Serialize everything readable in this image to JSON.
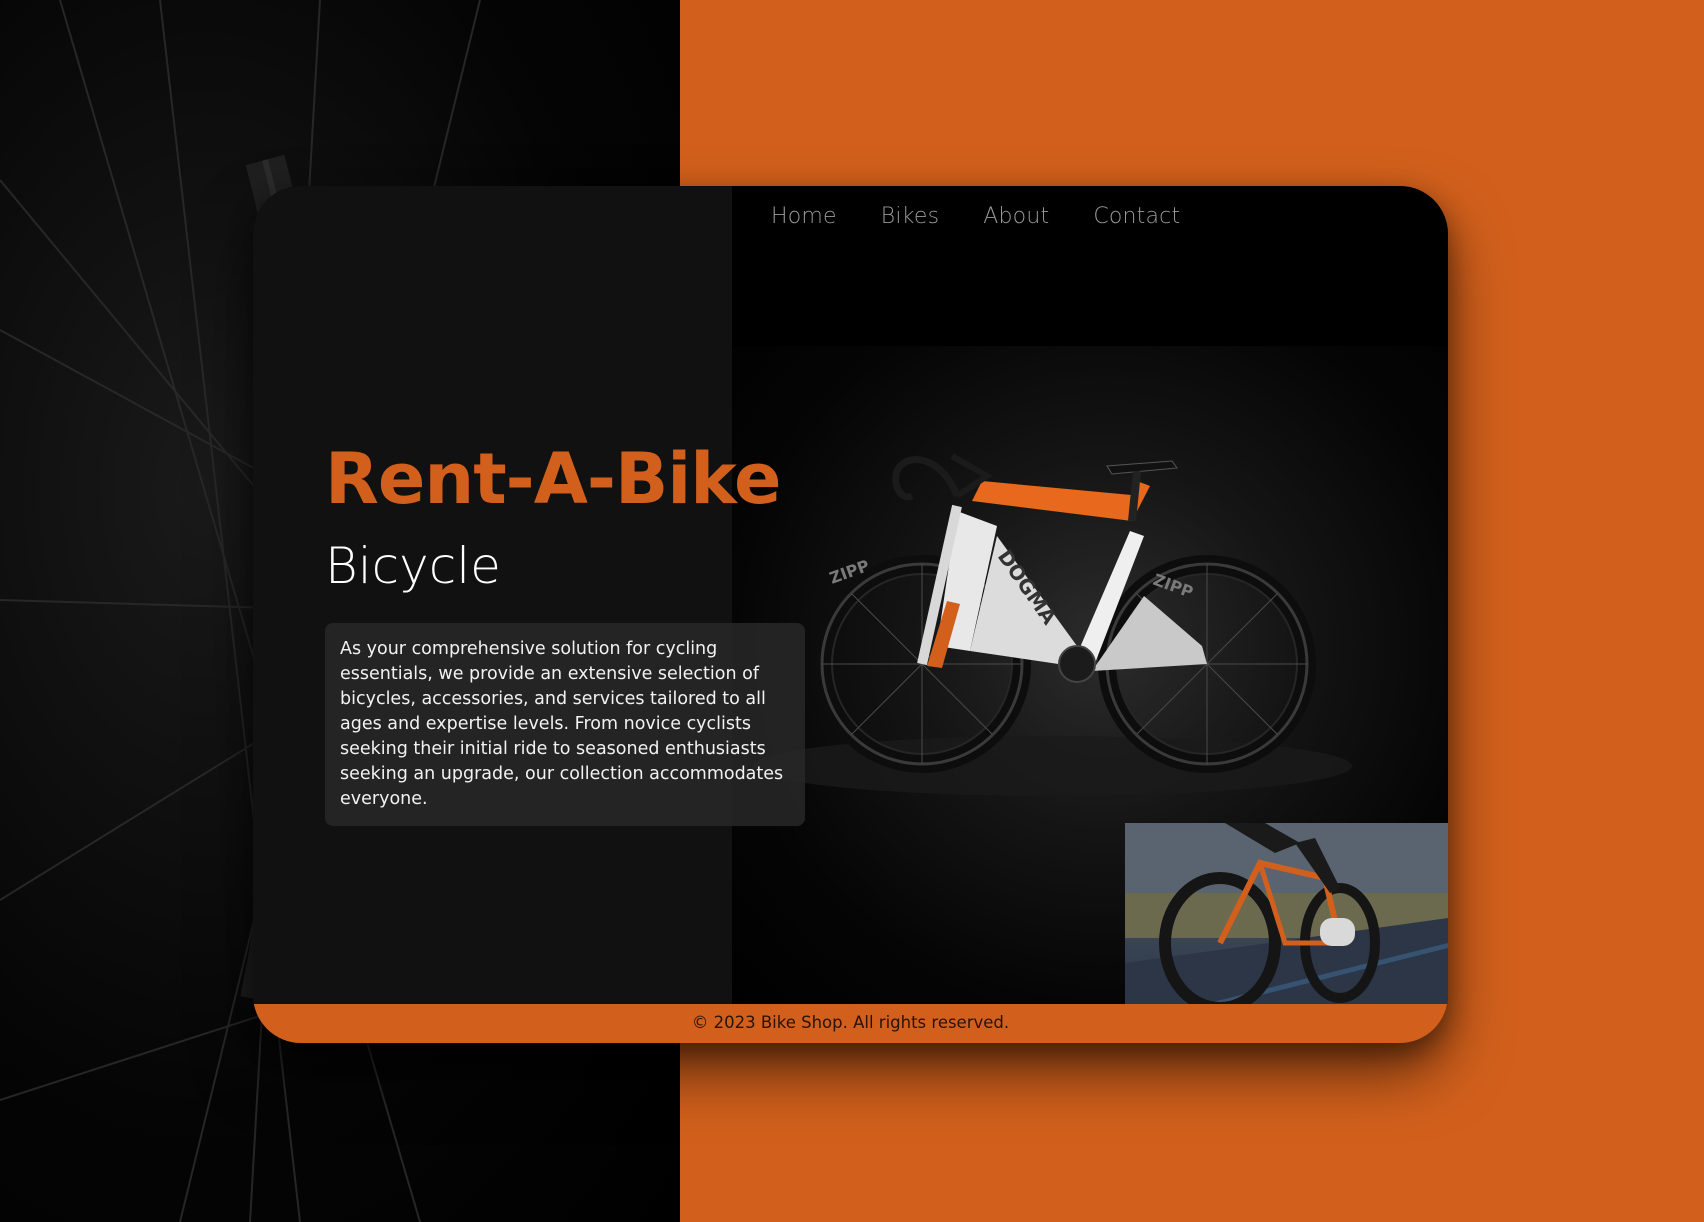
{
  "nav": {
    "items": [
      {
        "label": "Home"
      },
      {
        "label": "Bikes"
      },
      {
        "label": "About"
      },
      {
        "label": "Contact"
      }
    ]
  },
  "hero": {
    "title": "Rent-A-Bike",
    "subtitle": "Bicycle",
    "description": "As your comprehensive solution for cycling essentials, we provide an extensive selection of bicycles, accessories, and services tailored to all ages and expertise levels. From novice cyclists seeking their initial ride to seasoned enthusiasts seeking an upgrade, our collection accommodates everyone."
  },
  "footer": {
    "copyright": "© 2023 Bike Shop. All rights reserved."
  },
  "colors": {
    "accent": "#d2601c",
    "panel_dark": "#111111",
    "card_black": "#000000",
    "nav_text": "#9a9a9a"
  }
}
